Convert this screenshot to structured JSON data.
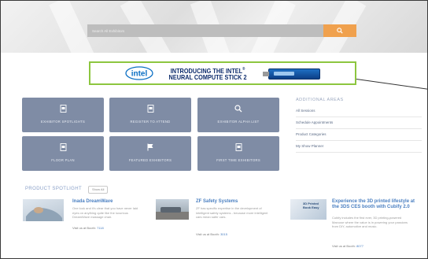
{
  "search": {
    "placeholder": "Search All Exhibitors"
  },
  "banner": {
    "brand": "intel",
    "line1": "INTRODUCING THE INTEL",
    "line1_mark": "®",
    "line2": "NEURAL COMPUTE STICK 2"
  },
  "tiles": [
    {
      "label": "EXHIBITOR SPOTLIGHTS",
      "icon": "document-icon"
    },
    {
      "label": "REGISTER TO ATTEND",
      "icon": "document-icon"
    },
    {
      "label": "EXHIBITOR ALPHA LIST",
      "icon": "search-icon"
    },
    {
      "label": "FLOOR PLAN",
      "icon": "document-icon"
    },
    {
      "label": "FEATURED EXHIBITORS",
      "icon": "flag-icon"
    },
    {
      "label": "FIRST TIME EXHIBITORS",
      "icon": "document-icon"
    }
  ],
  "sidebar": {
    "title": "ADDITIONAL AREAS",
    "items": [
      "All Sessions",
      "Schedule Appointments",
      "Product Categories",
      "My Show Planner"
    ]
  },
  "spotlight": {
    "title": "PRODUCT SPOTLIGHT",
    "show_all": "Show All",
    "cards": [
      {
        "title": "Inada DreamWave",
        "text": "One look and it's clear that you have never laid eyes on anything quite like the luxurious DreamWave massage chair.",
        "visit": "Visit us at Booth:",
        "booth": "7118"
      },
      {
        "title": "ZF Safety Systems",
        "text": "ZF has specific expertise in the development of intelligent safety systems - because more intelligent cars mean safer cars.",
        "visit": "Visit us at Booth:",
        "booth": "3015"
      },
      {
        "title": "Experience the 3D printed lifestyle at the 3DS CES booth with Cubify 2.0",
        "text": "Cubify includes the first ever, 3D printing-powered Marcuse where the value is in powering your passions from DIY, automotive and music.",
        "visit": "Visit us at Booth:",
        "booth": "8077",
        "image_text": "3D Printed Book Easy"
      }
    ]
  },
  "colors": {
    "tile": "#7f8ca5",
    "accent": "#f0a14e",
    "banner_border": "#8dc63f",
    "link": "#4a7fc1"
  }
}
